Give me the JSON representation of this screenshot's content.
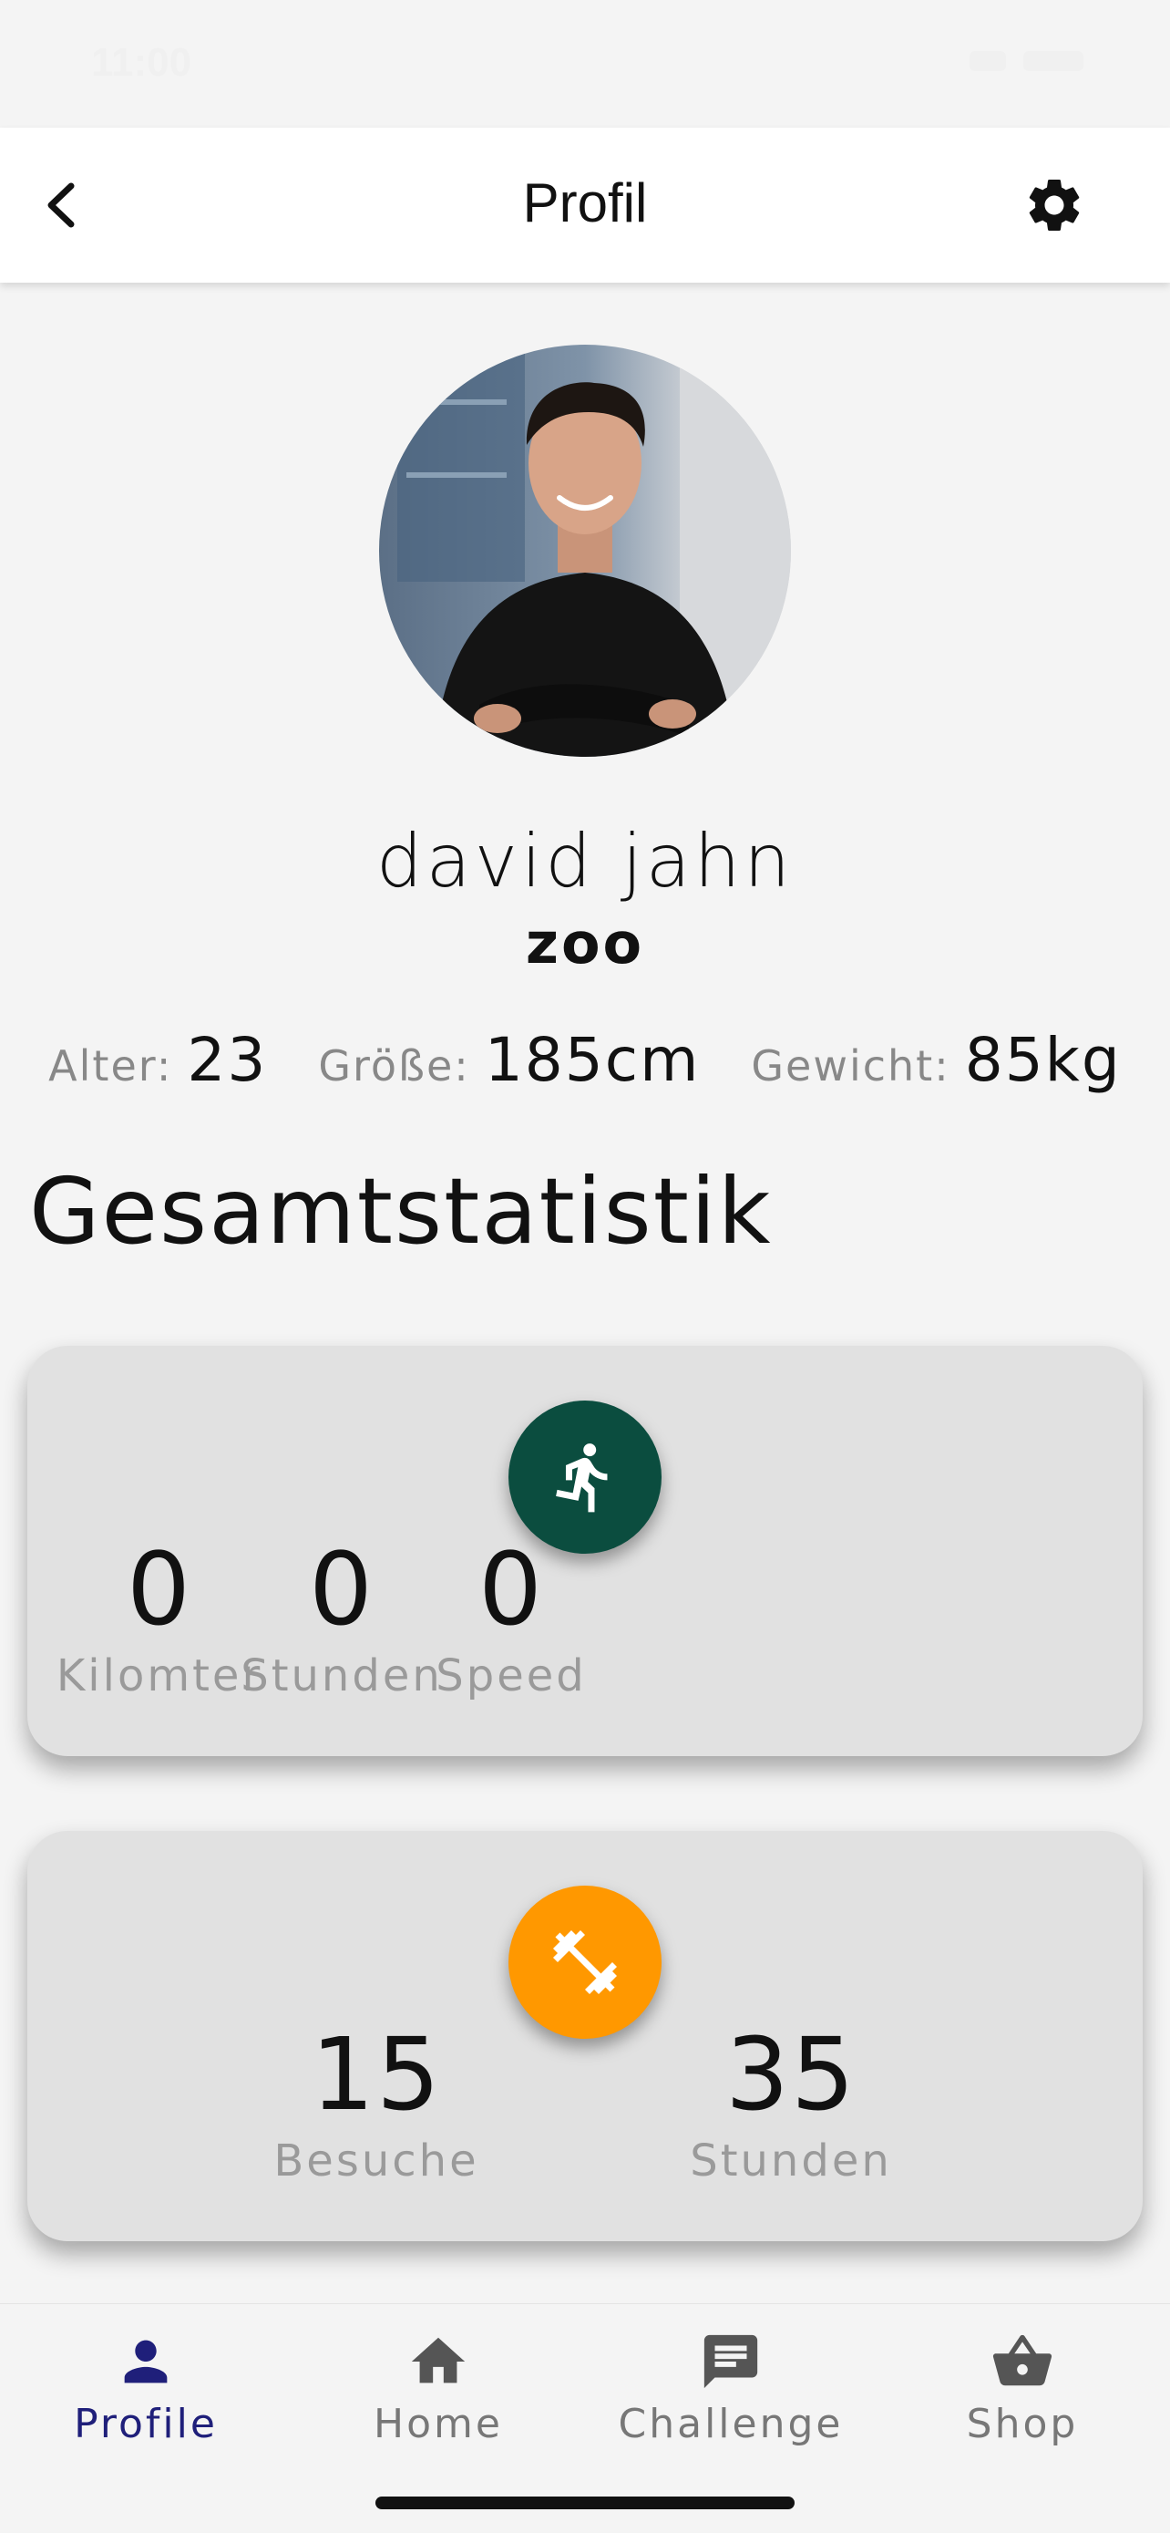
{
  "status_bar": {
    "time": "11:00"
  },
  "header": {
    "title": "Profil"
  },
  "profile": {
    "name": "david jahn",
    "gym": "zoo",
    "age_label": "Alter:",
    "age": "23",
    "height_label": "Größe:",
    "height": "185cm",
    "weight_label": "Gewicht:",
    "weight": "85kg"
  },
  "section_title": "Gesamtstatistik",
  "running_card": {
    "icon": "running-icon",
    "color": "#0b4d3f",
    "metrics": [
      {
        "value": "0",
        "label": "Kilomter"
      },
      {
        "value": "0",
        "label": "Stunden"
      },
      {
        "value": "0",
        "label": "Speed"
      }
    ]
  },
  "gym_card": {
    "icon": "dumbbell-icon",
    "color": "#ff9800",
    "metrics": [
      {
        "value": "15",
        "label": "Besuche"
      },
      {
        "value": "35",
        "label": "Stunden"
      }
    ]
  },
  "nav": {
    "active_color": "#1f1f7a",
    "items": [
      {
        "label": "Profile",
        "icon": "person-icon"
      },
      {
        "label": "Home",
        "icon": "home-icon"
      },
      {
        "label": "Challenge",
        "icon": "chat-icon"
      },
      {
        "label": "Shop",
        "icon": "basket-icon"
      }
    ]
  }
}
